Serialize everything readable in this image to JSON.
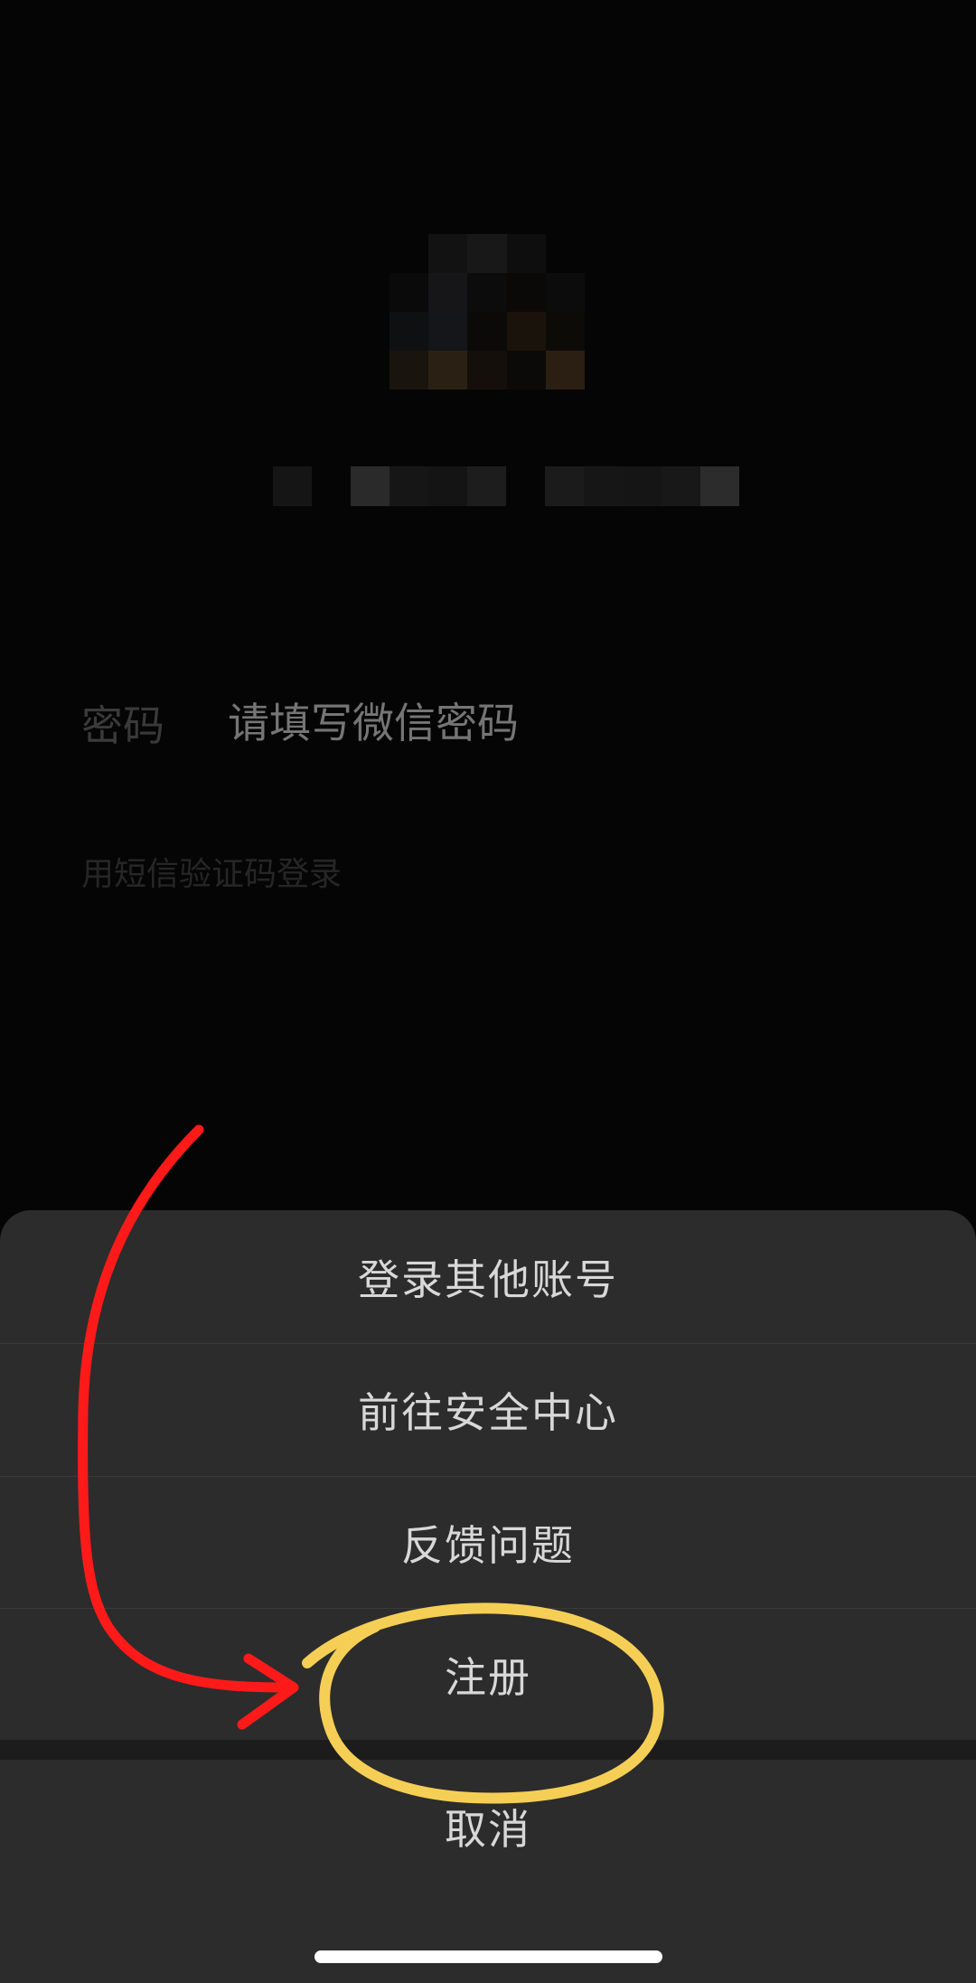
{
  "login": {
    "password_label": "密码",
    "password_placeholder": "请填写微信密码",
    "sms_login_link": "用短信验证码登录"
  },
  "action_sheet": {
    "items": [
      {
        "label": "登录其他账号"
      },
      {
        "label": "前往安全中心"
      },
      {
        "label": "反馈问题"
      },
      {
        "label": "注册"
      }
    ],
    "cancel_label": "取消"
  },
  "colors": {
    "sheet_background": "#2c2c2c",
    "sheet_text": "#d8d8d8",
    "annotation_arrow": "#ff1a1a",
    "annotation_circle": "#f5cf55"
  }
}
